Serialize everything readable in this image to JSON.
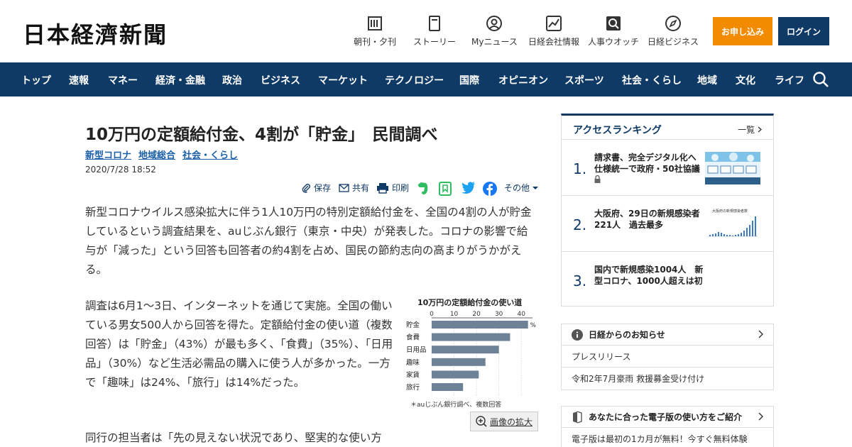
{
  "header": {
    "logo": "日本経濟新聞",
    "nav": [
      {
        "label": "朝刊・夕刊",
        "icon": "newspaper-icon"
      },
      {
        "label": "ストーリー",
        "icon": "book-icon"
      },
      {
        "label": "Myニュース",
        "icon": "user-icon"
      },
      {
        "label": "日経会社情報",
        "icon": "chart-icon"
      },
      {
        "label": "人事ウオッチ",
        "icon": "magnifier-icon"
      },
      {
        "label": "日経ビジネス",
        "icon": "compass-icon"
      }
    ],
    "subscribe_label": "お申し込み",
    "login_label": "ログイン"
  },
  "category_nav": [
    "トップ",
    "速報",
    "マネー",
    "経済・金融",
    "政治",
    "ビジネス",
    "マーケット",
    "テクノロジー",
    "国際",
    "オピニオン",
    "スポーツ",
    "社会・くらし",
    "地域",
    "文化",
    "ライフ"
  ],
  "article": {
    "title": "10万円の定額給付金、4割が「貯金」　民間調べ",
    "tags": [
      "新型コロナ",
      "地域総合",
      "社会・くらし"
    ],
    "date": "2020/7/28 18:52",
    "share": {
      "save": "保存",
      "share": "共有",
      "print": "印刷",
      "more": "その他"
    },
    "paragraphs": [
      "新型コロナウイルス感染拡大に伴う1人10万円の特別定額給付金を、全国の4割の人が貯金しているという調査結果を、auじぶん銀行（東京・中央）が発表した。コロナの影響で給与が「減った」という回答も回答者の約4割を占め、国民の節約志向の高まりがうかがえる。",
      "調査は6月1～3日、インターネットを通じて実施。全国の働いている男女500人から回答を得た。定額給付金の使い道（複数回答）は「貯金」（43%）が最も多く、「食費」（35%）、「日用品」（30%）など生活必需品の購入に使う人が多かった。一方で「趣味」は24%、「旅行」は14%だった。",
      "同行の担当者は「先の見えない状況であり、堅実的な使い方"
    ],
    "zoom_label": "画像の拡大"
  },
  "chart_data": {
    "type": "bar",
    "orientation": "horizontal",
    "title": "10万円の定額給付金の使い道",
    "categories": [
      "貯金",
      "食費",
      "日用品",
      "趣味",
      "家賃",
      "旅行"
    ],
    "values": [
      43,
      35,
      30,
      24,
      21,
      14
    ],
    "unit": "%",
    "xlim": [
      0,
      45
    ],
    "xticks": [
      0,
      10,
      20,
      30,
      40
    ],
    "note": "＊auじぶん銀行調べ、複数回答",
    "bar_color": "#6d8197"
  },
  "sidebar": {
    "ranking": {
      "title": "アクセスランキング",
      "all_label": "一覧",
      "items": [
        {
          "num": "1.",
          "text": "請求書、完全デジタル化へ　仕様統一で政府・50社協議"
        },
        {
          "num": "2.",
          "text": "大阪府、29日の新規感染者221人　過去最多"
        },
        {
          "num": "3.",
          "text": "国内で新規感染1004人　新型コロナ、1000人超えは初"
        }
      ],
      "thumb2_caption": "大阪府の新規感染者数"
    },
    "notice": {
      "title": "日経からのお知らせ",
      "rows": [
        "プレスリリース",
        "令和2年7月豪雨 救援募金受け付け"
      ]
    },
    "guide": {
      "title": "あなたに合った電子版の使い方をご紹介",
      "rows": [
        "電子版は最初の1カ月が無料！今すぐ無料体験"
      ]
    }
  }
}
